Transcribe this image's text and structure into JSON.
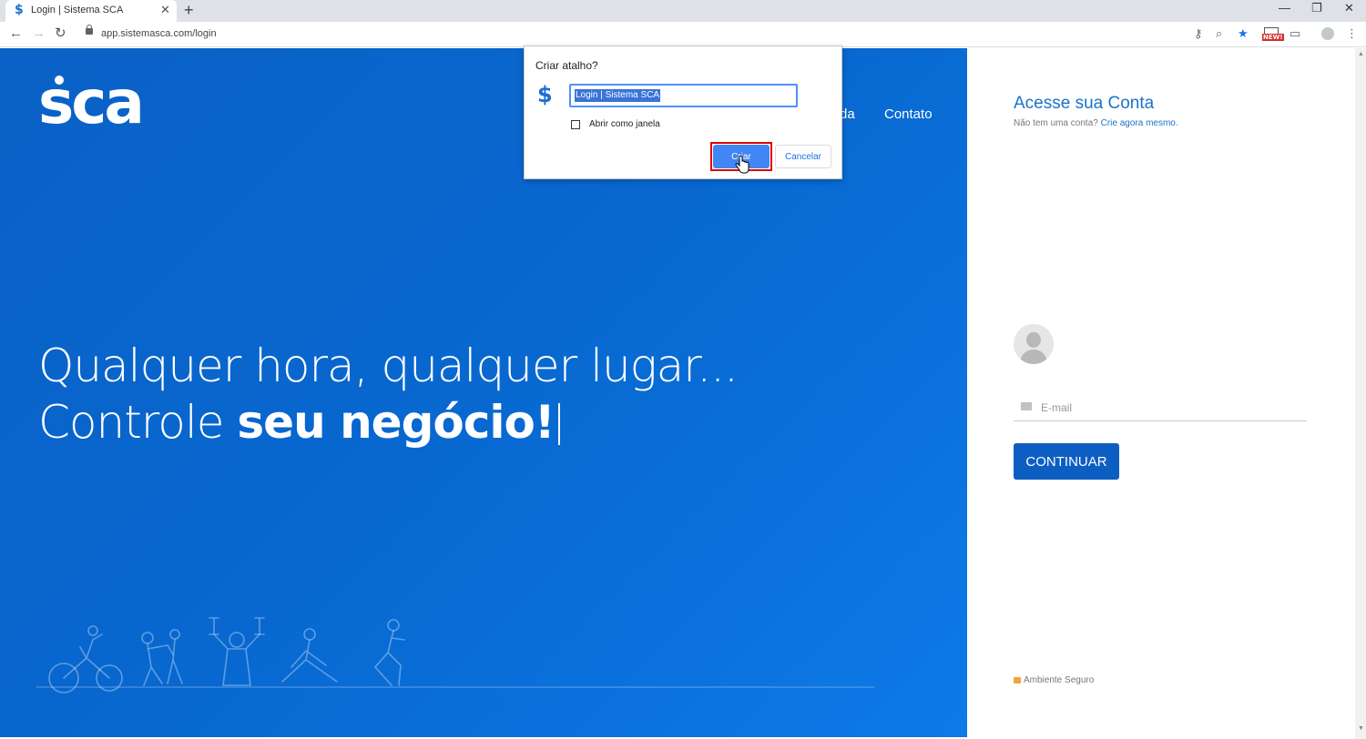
{
  "browser": {
    "tab_title": "Login | Sistema SCA",
    "tab_close": "✕",
    "new_tab": "+",
    "url": "app.sistemasca.com/login",
    "window_controls": {
      "minimize": "—",
      "restore": "❐",
      "close": "✕"
    },
    "nav": {
      "back": "←",
      "forward": "→",
      "reload": "↻"
    },
    "toolbar_icons": {
      "key": "⚷",
      "zoom": "⌕",
      "star": "★",
      "cast": "▭",
      "menu": "⋮"
    },
    "extension_badge": "NEW!"
  },
  "page": {
    "logo_text": "sca",
    "nav_partial": "da",
    "nav_contato": "Contato",
    "headline_line1": "Qualquer hora, qualquer lugar...",
    "headline_line2_regular": "Controle ",
    "headline_line2_bold": "seu negócio!",
    "colors": {
      "hero": "#0868d0",
      "accent": "#1a73c9",
      "button": "#0d5ec2"
    }
  },
  "login": {
    "title": "Acesse sua Conta",
    "subtitle": "Não tem uma conta?",
    "subtitle_link": "Crie agora mesmo.",
    "email_placeholder": "E-mail",
    "continue_label": "CONTINUAR",
    "secure_label": "Ambiente Seguro"
  },
  "dialog": {
    "title": "Criar atalho?",
    "input_value": "Login | Sistema SCA",
    "checkbox_label": "Abrir como janela",
    "checkbox_checked": false,
    "confirm_label": "Criar",
    "cancel_label": "Cancelar",
    "icon_glyph": "$"
  }
}
